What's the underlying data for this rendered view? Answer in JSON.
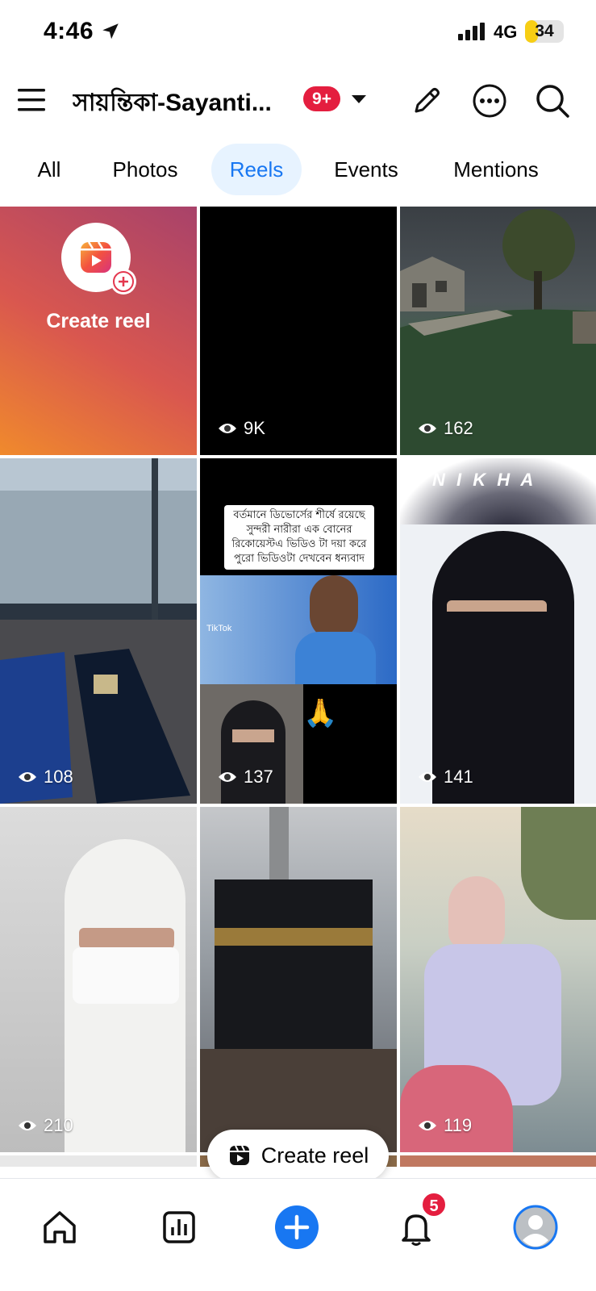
{
  "status_bar": {
    "time": "4:46",
    "network": "4G",
    "battery": "34",
    "battery_level": 0.34
  },
  "header": {
    "page_name": "সায়ন্তিকা-Sayanti...",
    "notification_badge": "9+"
  },
  "tabs": [
    {
      "label": "All",
      "active": false
    },
    {
      "label": "Photos",
      "active": false
    },
    {
      "label": "Reels",
      "active": true
    },
    {
      "label": "Events",
      "active": false
    },
    {
      "label": "Mentions",
      "active": false
    }
  ],
  "grid": {
    "create_label": "Create reel",
    "reels": [
      {
        "views": "9K",
        "thumb": "black"
      },
      {
        "views": "162",
        "thumb": "village-landscape"
      },
      {
        "views": "108",
        "thumb": "prayer-mats-window"
      },
      {
        "views": "137",
        "thumb": "tiktok-collage",
        "caption": "বর্তমানে ডিভোর্সের শীর্ষে রয়েছে সুন্দরী নারীরা এক বোনের রিকোয়েস্টএ ভিডিও টা দয়া করে পুরো ভিডিওটা দেখবেন ধন্যবাদ",
        "tiktok_label": "TikTok"
      },
      {
        "views": "141",
        "thumb": "niqab-headset",
        "overlay_text": "N I K H A"
      },
      {
        "views": "210",
        "thumb": "white-niqab"
      },
      {
        "views": "",
        "thumb": "kaaba-rain"
      },
      {
        "views": "119",
        "thumb": "hijab-garden"
      }
    ]
  },
  "floating_button": {
    "label": "Create reel"
  },
  "bottom_nav": {
    "notification_count": "5"
  },
  "colors": {
    "accent": "#1877f2",
    "badge": "#e41e3f"
  }
}
